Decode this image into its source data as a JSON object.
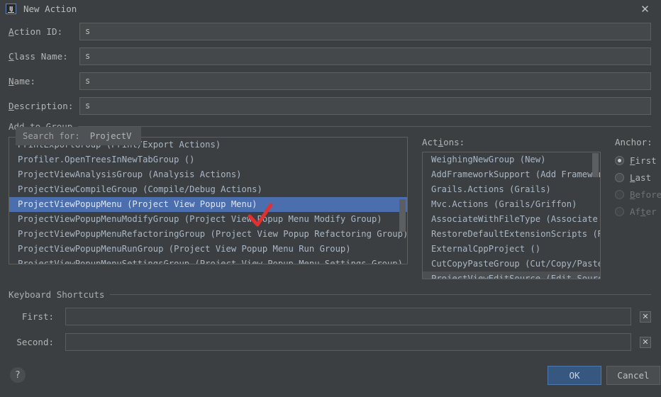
{
  "window": {
    "title": "New Action",
    "logo_text": "IJ",
    "close_label": "✕"
  },
  "form": {
    "fields": [
      {
        "label_mn": "A",
        "label_rest": "ction ID:",
        "value": "s"
      },
      {
        "label_mn": "C",
        "label_rest": "lass Name:",
        "value": "s"
      },
      {
        "label_mn": "N",
        "label_rest": "ame:",
        "value": "s"
      },
      {
        "label_mn": "D",
        "label_rest": "escription:",
        "value": "s"
      }
    ]
  },
  "add_to_group": {
    "title": "Add to Group",
    "search": {
      "label": "Search for:",
      "value": "ProjectV"
    },
    "items": [
      {
        "text": "PrintExportGroup (Print/Export Actions)",
        "selected": false
      },
      {
        "text": "Profiler.OpenTreesInNewTabGroup ()",
        "selected": false
      },
      {
        "text": "ProjectViewAnalysisGroup (Analysis Actions)",
        "selected": false
      },
      {
        "text": "ProjectViewCompileGroup (Compile/Debug Actions)",
        "selected": false
      },
      {
        "text": "ProjectViewPopupMenu (Project View Popup Menu)",
        "selected": true
      },
      {
        "text": "ProjectViewPopupMenuModifyGroup (Project View Popup Menu Modify Group)",
        "selected": false
      },
      {
        "text": "ProjectViewPopupMenuRefactoringGroup (Project View Popup Refactoring Group)",
        "selected": false
      },
      {
        "text": "ProjectViewPopupMenuRunGroup (Project View Popup Menu Run Group)",
        "selected": false
      },
      {
        "text": "ProjectViewPopupMenuSettingsGroup (Project View Popup Menu Settings Group)",
        "selected": false
      }
    ]
  },
  "actions": {
    "label": "Actions:",
    "items": [
      {
        "text": "WeighingNewGroup (New)",
        "soft": false
      },
      {
        "text": "AddFrameworkSupport (Add Framework",
        "soft": false
      },
      {
        "text": "Grails.Actions (Grails)",
        "soft": false
      },
      {
        "text": "Mvc.Actions (Grails/Griffon)",
        "soft": false
      },
      {
        "text": "AssociateWithFileType (Associate wi",
        "soft": false
      },
      {
        "text": "RestoreDefaultExtensionScripts (Res",
        "soft": false
      },
      {
        "text": "ExternalCppProject ()",
        "soft": false
      },
      {
        "text": "CutCopyPasteGroup (Cut/Copy/Paste A",
        "soft": false
      },
      {
        "text": "ProjectViewEditSource (Edit Source)",
        "soft": true
      }
    ]
  },
  "anchor": {
    "label": "Anchor:",
    "options": [
      {
        "mn": "F",
        "rest": "irst",
        "selected": true,
        "disabled": false
      },
      {
        "mn": "L",
        "rest": "ast",
        "selected": false,
        "disabled": false
      },
      {
        "mn": "B",
        "rest": "efore",
        "selected": false,
        "disabled": true
      },
      {
        "mn": "Af",
        "rest": "ter",
        "selected": false,
        "disabled": true
      }
    ]
  },
  "keyboard_shortcuts": {
    "title": "Keyboard Shortcuts",
    "rows": [
      {
        "label": "First:",
        "value": "",
        "clear_label": "✕"
      },
      {
        "label": "Second:",
        "value": "",
        "clear_label": "✕"
      }
    ]
  },
  "footer": {
    "help_label": "?",
    "ok_label": "OK",
    "cancel_label": "Cancel"
  },
  "annotation": {
    "type": "red-checkmark",
    "color": "#e03030"
  }
}
